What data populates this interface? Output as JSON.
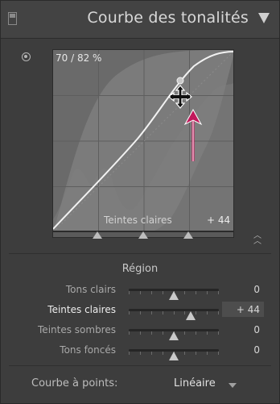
{
  "panel": {
    "title": "Courbe des tonalités",
    "collapse_icon": "triangle-down-icon",
    "grip_icon": "panel-switch-icon"
  },
  "curve": {
    "readout": "70 / 82 %",
    "region_label": "Teintes claires",
    "region_value": "+ 44",
    "split_points": [
      0.25,
      0.5,
      0.75
    ]
  },
  "region": {
    "title": "Région",
    "sliders": [
      {
        "label": "Tons clairs",
        "value": "0",
        "level": 0.5,
        "active": false
      },
      {
        "label": "Teintes claires",
        "value": "+ 44",
        "level": 0.69,
        "active": true
      },
      {
        "label": "Teintes sombres",
        "value": "0",
        "level": 0.5,
        "active": false
      },
      {
        "label": "Tons foncés",
        "value": "0",
        "level": 0.5,
        "active": false
      }
    ]
  },
  "footer": {
    "label": "Courbe à points:",
    "select_value": "Linéaire"
  },
  "colors": {
    "annotation_arrow": "#c2185b",
    "curve_line": "#f2f2f2"
  }
}
